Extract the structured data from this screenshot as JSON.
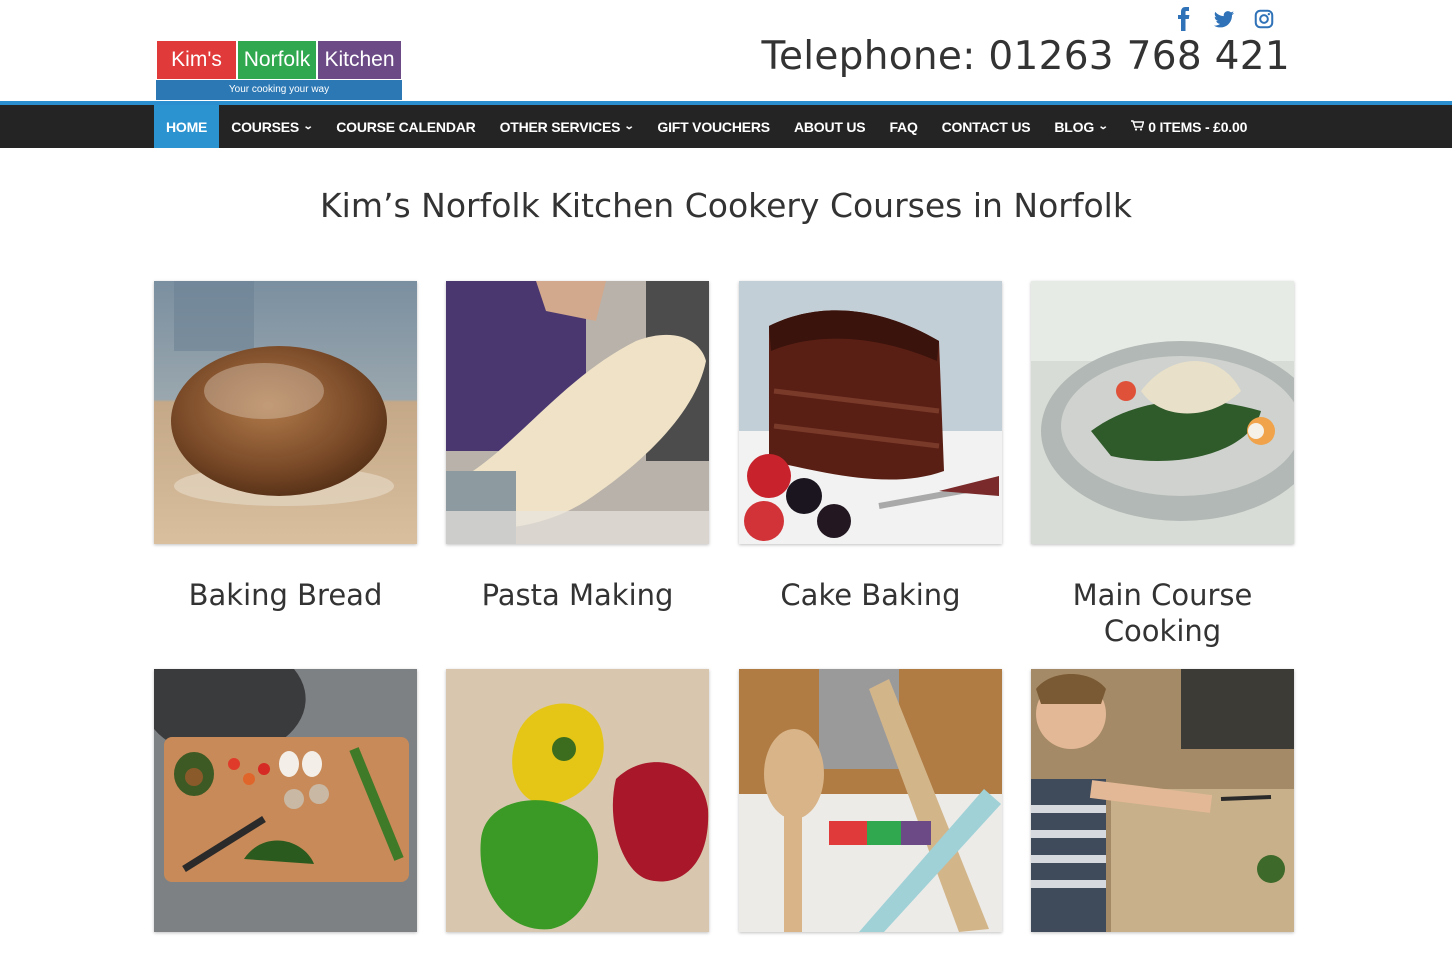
{
  "logo": {
    "part1": "Kim's",
    "part2": "Norfolk",
    "part3": "Kitchen",
    "tagline": "Your cooking your way",
    "colors": {
      "red": "#e03a3a",
      "green": "#2fa84f",
      "purple": "#6b4a86",
      "blue": "#2b78b5"
    }
  },
  "social": [
    "facebook-icon",
    "twitter-icon",
    "instagram-icon"
  ],
  "phone": "Telephone: 01263 768 421",
  "nav": {
    "home": "HOME",
    "courses": "COURSES",
    "calendar": "COURSE CALENDAR",
    "other": "OTHER SERVICES",
    "vouchers": "GIFT VOUCHERS",
    "about": "ABOUT US",
    "faq": "FAQ",
    "contact": "CONTACT US",
    "blog": "BLOG",
    "cart": "0 ITEMS - £0.00"
  },
  "heading": "Kim’s Norfolk Kitchen Cookery Courses in Norfolk",
  "courses": [
    {
      "title": "Baking Bread",
      "image": "bread-loaf"
    },
    {
      "title": "Pasta Making",
      "image": "pasta-sheet"
    },
    {
      "title": "Cake Baking",
      "image": "chocolate-cake"
    },
    {
      "title": "Main Course Cooking",
      "image": "salad-plate"
    },
    {
      "title": "",
      "image": "chopping-board"
    },
    {
      "title": "",
      "image": "peppers"
    },
    {
      "title": "",
      "image": "utensils-apron"
    },
    {
      "title": "",
      "image": "child-cooking"
    }
  ],
  "accent_colors": {
    "nav_bg": "#242424",
    "nav_active": "#2b94d0",
    "social": "#2f72b7"
  }
}
